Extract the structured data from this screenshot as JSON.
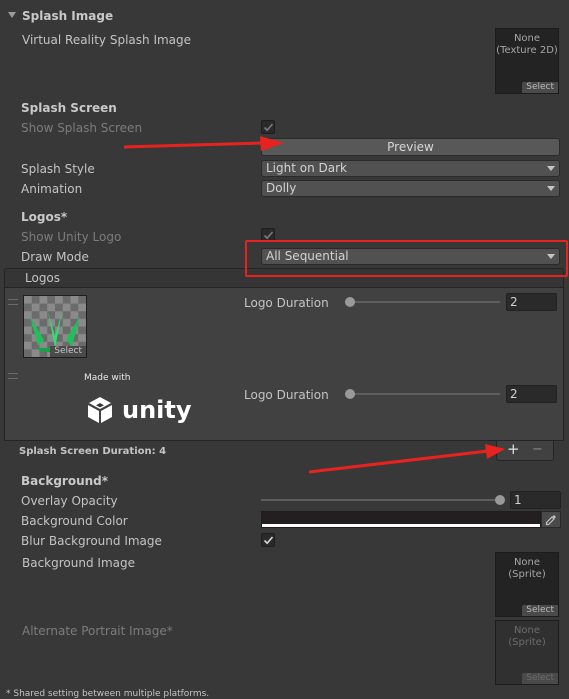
{
  "splash_image": {
    "foldout_title": "Splash Image",
    "vr_label": "Virtual Reality Splash Image",
    "vr_slot": {
      "line1": "None",
      "line2": "(Texture 2D)",
      "select": "Select"
    }
  },
  "splash_screen": {
    "header": "Splash Screen",
    "show_label": "Show Splash Screen",
    "show_checked": true,
    "preview_button": "Preview",
    "style_label": "Splash Style",
    "style_value": "Light on Dark",
    "animation_label": "Animation",
    "animation_value": "Dolly"
  },
  "logos": {
    "header": "Logos*",
    "show_unity_label": "Show Unity Logo",
    "show_unity_checked": true,
    "draw_mode_label": "Draw Mode",
    "draw_mode_value": "All Sequential",
    "list_title": "Logos",
    "items": [
      {
        "duration_label": "Logo Duration",
        "duration_value": "2",
        "select": "Select"
      },
      {
        "duration_label": "Logo Duration",
        "duration_value": "2",
        "made_with": "Made with",
        "unity_text": "unity"
      }
    ],
    "splash_duration": "Splash Screen Duration: 4",
    "add_symbol": "+",
    "remove_symbol": "−"
  },
  "background": {
    "header": "Background*",
    "opacity_label": "Overlay Opacity",
    "opacity_value": "1",
    "color_label": "Background Color",
    "color_hex": "#231f20",
    "blur_label": "Blur Background Image",
    "blur_checked": true,
    "image_label": "Background Image",
    "image_slot": {
      "line1": "None",
      "line2": "(Sprite)",
      "select": "Select"
    },
    "portrait_label": "Alternate Portrait Image*",
    "portrait_slot": {
      "line1": "None",
      "line2": "(Sprite)",
      "select": "Select"
    }
  },
  "footnote": "* Shared setting between multiple platforms.",
  "annotation_color": "#e8231f",
  "icons": [
    "foldout-triangle-icon",
    "checkmark-icon",
    "dropdown-arrow-icon",
    "eyedropper-icon",
    "drag-handle-icon",
    "unity-logo-icon"
  ]
}
